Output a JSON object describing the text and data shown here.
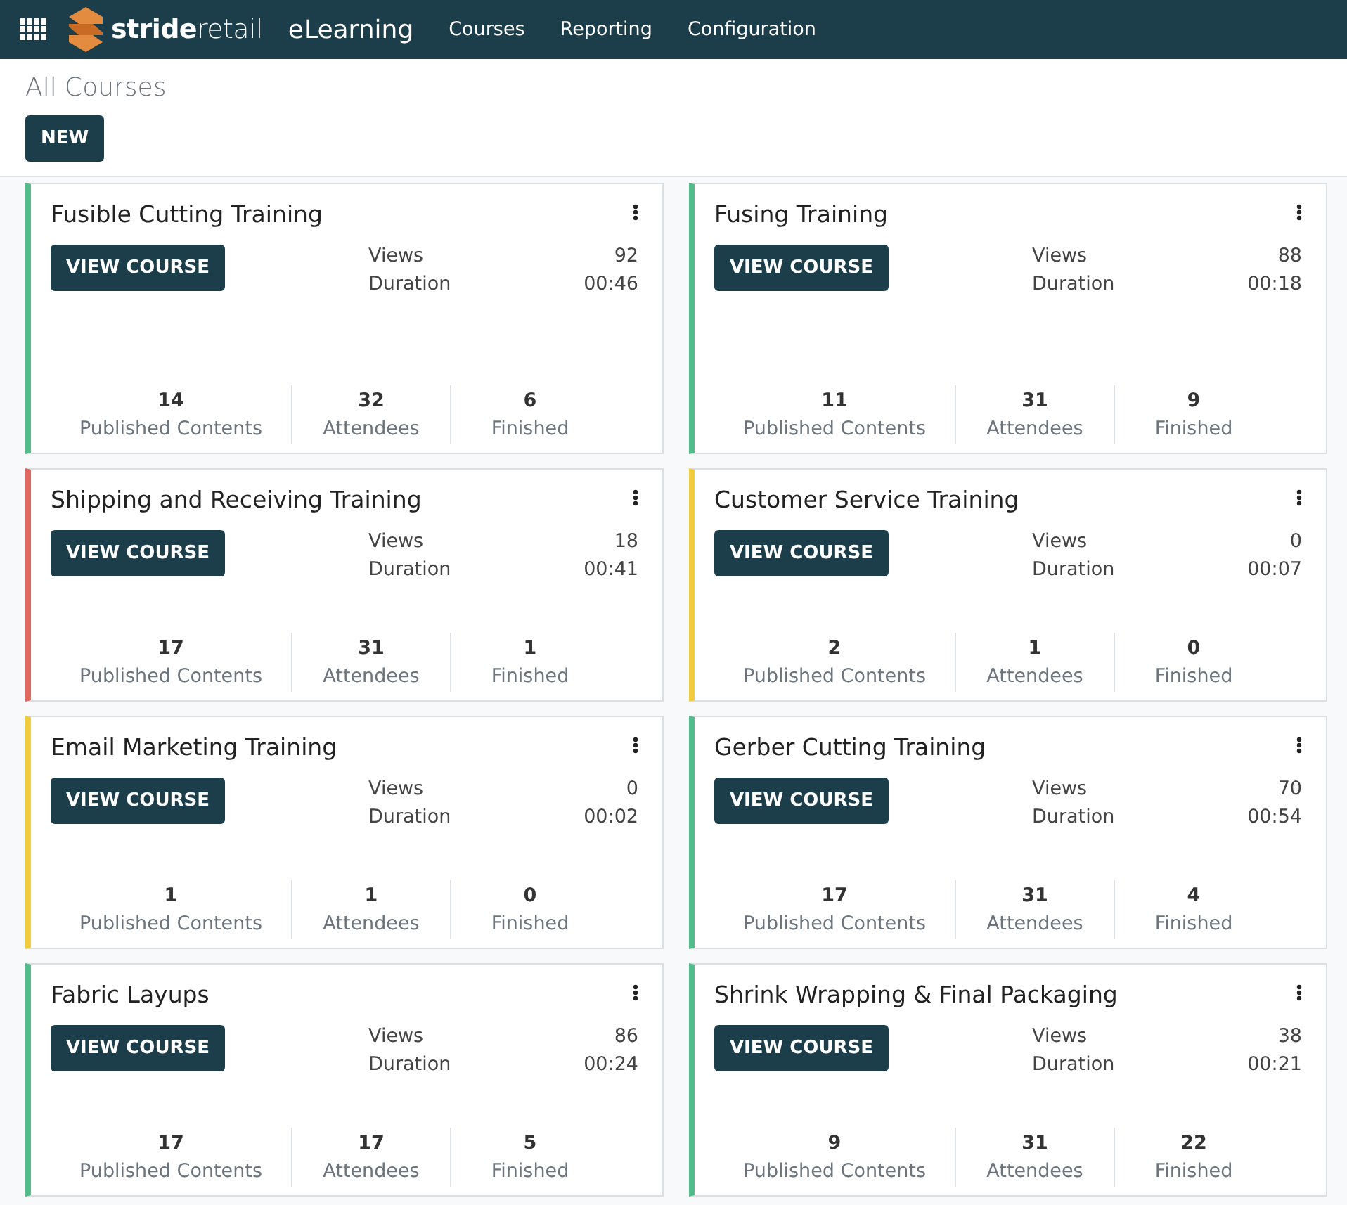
{
  "navbar": {
    "logo": "**stride**retail",
    "app": "eLearning",
    "menu": [
      "Courses",
      "Reporting",
      "Configuration"
    ]
  },
  "page": {
    "title": "All Courses",
    "new_button": "NEW"
  },
  "courses": [
    {
      "title": "Fusible Cutting Training",
      "color": "#52bd8b",
      "button": "VIEW COURSE",
      "views_label": "Views",
      "views": "92",
      "duration_label": "Duration",
      "duration": "00:46",
      "stats": [
        {
          "value": "14",
          "label": "Published Contents"
        },
        {
          "value": "32",
          "label": "Attendees"
        },
        {
          "value": "6",
          "label": "Finished"
        }
      ]
    },
    {
      "title": "Fusing Training",
      "color": "#52bd8b",
      "button": "VIEW COURSE",
      "views_label": "Views",
      "views": "88",
      "duration_label": "Duration",
      "duration": "00:18",
      "stats": [
        {
          "value": "11",
          "label": "Published Contents"
        },
        {
          "value": "31",
          "label": "Attendees"
        },
        {
          "value": "9",
          "label": "Finished"
        }
      ]
    },
    {
      "title": "Shipping and Receiving Training",
      "color": "#e0685e",
      "button": "VIEW COURSE",
      "views_label": "Views",
      "views": "18",
      "duration_label": "Duration",
      "duration": "00:41",
      "stats": [
        {
          "value": "17",
          "label": "Published Contents"
        },
        {
          "value": "31",
          "label": "Attendees"
        },
        {
          "value": "1",
          "label": "Finished"
        }
      ]
    },
    {
      "title": "Customer Service Training",
      "color": "#f2cc3d",
      "button": "VIEW COURSE",
      "views_label": "Views",
      "views": "0",
      "duration_label": "Duration",
      "duration": "00:07",
      "stats": [
        {
          "value": "2",
          "label": "Published Contents"
        },
        {
          "value": "1",
          "label": "Attendees"
        },
        {
          "value": "0",
          "label": "Finished"
        }
      ]
    },
    {
      "title": "Email Marketing Training",
      "color": "#f2cc3d",
      "button": "VIEW COURSE",
      "views_label": "Views",
      "views": "0",
      "duration_label": "Duration",
      "duration": "00:02",
      "stats": [
        {
          "value": "1",
          "label": "Published Contents"
        },
        {
          "value": "1",
          "label": "Attendees"
        },
        {
          "value": "0",
          "label": "Finished"
        }
      ]
    },
    {
      "title": "Gerber Cutting Training",
      "color": "#52bd8b",
      "button": "VIEW COURSE",
      "views_label": "Views",
      "views": "70",
      "duration_label": "Duration",
      "duration": "00:54",
      "stats": [
        {
          "value": "17",
          "label": "Published Contents"
        },
        {
          "value": "31",
          "label": "Attendees"
        },
        {
          "value": "4",
          "label": "Finished"
        }
      ]
    },
    {
      "title": "Fabric Layups",
      "color": "#52bd8b",
      "button": "VIEW COURSE",
      "views_label": "Views",
      "views": "86",
      "duration_label": "Duration",
      "duration": "00:24",
      "stats": [
        {
          "value": "17",
          "label": "Published Contents"
        },
        {
          "value": "17",
          "label": "Attendees"
        },
        {
          "value": "5",
          "label": "Finished"
        }
      ]
    },
    {
      "title": "Shrink Wrapping & Final Packaging",
      "color": "#52bd8b",
      "button": "VIEW COURSE",
      "views_label": "Views",
      "views": "38",
      "duration_label": "Duration",
      "duration": "00:21",
      "stats": [
        {
          "value": "9",
          "label": "Published Contents"
        },
        {
          "value": "31",
          "label": "Attendees"
        },
        {
          "value": "22",
          "label": "Finished"
        }
      ]
    }
  ]
}
